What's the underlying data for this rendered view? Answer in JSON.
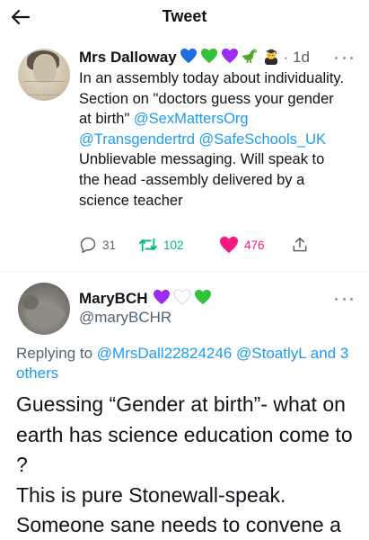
{
  "header": {
    "title": "Tweet"
  },
  "parent_tweet": {
    "author_name": "Mrs Dalloway",
    "time": "1d",
    "emoji_names": [
      "blue-heart",
      "green-heart",
      "purple-heart",
      "dinosaur",
      "teacher"
    ],
    "text_1": "In an assembly today about individuality. Section on \"doctors guess your gender at birth\" ",
    "mention_1": "@SexMattersOrg",
    "mention_2": "@Transgendertrd",
    "mention_3": "@SafeSchools_UK",
    "text_2": " Unblievable messaging. Will speak to the head -assembly delivered by a science teacher",
    "reply_count": "31",
    "retweet_count": "102",
    "like_count": "476"
  },
  "reply_tweet": {
    "author_name": "MaryBCH",
    "handle": "@maryBCHR",
    "emoji_names": [
      "purple-heart",
      "white-heart",
      "green-heart"
    ],
    "replying_prefix": "Replying to ",
    "replying_mentions": "@MrsDall22824246 @StoatlyL and 3 others",
    "text_line_1": "Guessing “Gender at birth”- what on earth has science education come to ?",
    "text_line_2": "This is pure Stonewall-speak. Someone sane needs to convene a"
  },
  "colors": {
    "link": "#1d9bf0",
    "secondary_text": "#536471",
    "retweet_green": "#00ba7c",
    "like_pink": "#f91880",
    "blue_heart": "#1d6fe0",
    "green_heart": "#34c23a",
    "purple_heart": "#9b2cf0"
  }
}
